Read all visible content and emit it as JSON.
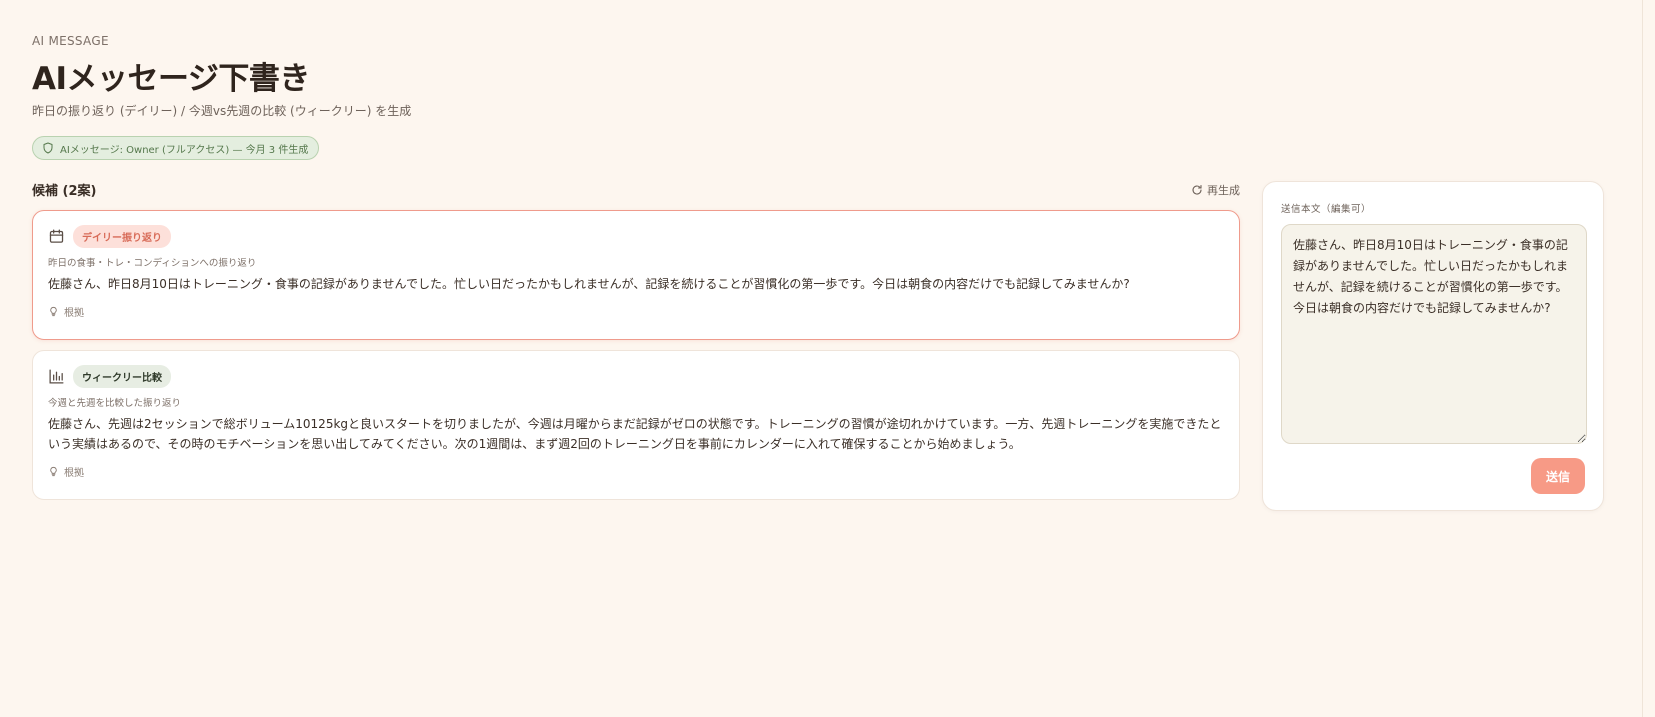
{
  "header": {
    "eyebrow": "AI MESSAGE",
    "title": "AIメッセージ下書き",
    "subtitle": "昨日の振り返り (デイリー) / 今週vs先週の比較 (ウィークリー) を生成"
  },
  "access_badge": {
    "icon": "shield-icon",
    "text": "AIメッセージ: Owner (フルアクセス) — 今月 3 件生成"
  },
  "candidates": {
    "title": "候補 (2案)",
    "regenerate_label": "再生成",
    "cards": [
      {
        "icon": "calendar-icon",
        "tag": "デイリー振り返り",
        "description": "昨日の食事・トレ・コンディションへの振り返り",
        "body": "佐藤さん、昨日8月10日はトレーニング・食事の記録がありませんでした。忙しい日だったかもしれませんが、記録を続けることが習慣化の第一歩です。今日は朝食の内容だけでも記録してみませんか?",
        "evidence_label": "根拠"
      },
      {
        "icon": "bar-chart-icon",
        "tag": "ウィークリー比較",
        "description": "今週と先週を比較した振り返り",
        "body": "佐藤さん、先週は2セッションで総ボリューム10125kgと良いスタートを切りましたが、今週は月曜からまだ記録がゼロの状態です。トレーニングの習慣が途切れかけています。一方、先週トレーニングを実施できたという実績はあるので、その時のモチベーションを思い出してみてください。次の1週間は、まず週2回のトレーニング日を事前にカレンダーに入れて確保することから始めましょう。",
        "evidence_label": "根拠"
      }
    ]
  },
  "send_panel": {
    "label": "送信本文（編集可）",
    "message": "佐藤さん、昨日8月10日はトレーニング・食事の記録がありませんでした。忙しい日だったかもしれませんが、記録を続けることが習慣化の第一歩です。今日は朝食の内容だけでも記録してみませんか?",
    "send_label": "送信"
  },
  "colors": {
    "background": "#fdf6ef",
    "accent": "#f79a86",
    "selected_border": "#ef9b8c",
    "badge_green": "#55784c"
  }
}
